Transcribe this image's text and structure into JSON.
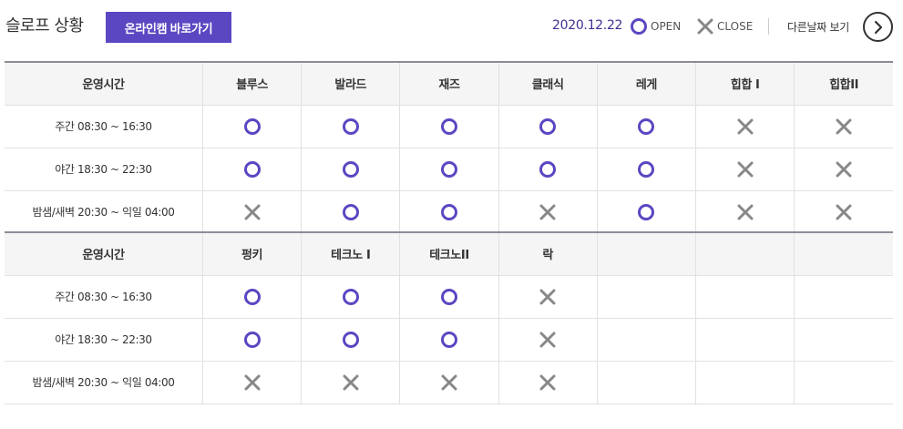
{
  "header": {
    "title": "슬로프 상황",
    "cam_button_label": "온라인캠 바로가기",
    "date": "2020.12.22",
    "legend_open": "OPEN",
    "legend_close": "CLOSE",
    "other_date_label": "다른날짜 보기"
  },
  "colors": {
    "accent": "#5b47c2",
    "date_text": "#3d3393",
    "close_icon": "#888888"
  },
  "table1": {
    "time_header": "운영시간",
    "columns": [
      "블루스",
      "발라드",
      "재즈",
      "클래식",
      "레게",
      "힙합 I",
      "힙합II"
    ],
    "rows": [
      {
        "time": "주간 08:30 ~ 16:30",
        "status": [
          "open",
          "open",
          "open",
          "open",
          "open",
          "close",
          "close"
        ]
      },
      {
        "time": "야간 18:30 ~ 22:30",
        "status": [
          "open",
          "open",
          "open",
          "open",
          "open",
          "close",
          "close"
        ]
      },
      {
        "time": "밤샘/새벽 20:30 ~ 익일 04:00",
        "status": [
          "close",
          "open",
          "open",
          "close",
          "open",
          "close",
          "close"
        ]
      }
    ]
  },
  "table2": {
    "time_header": "운영시간",
    "columns": [
      "펑키",
      "테크노 I",
      "테크노II",
      "락",
      "",
      "",
      ""
    ],
    "rows": [
      {
        "time": "주간 08:30 ~ 16:30",
        "status": [
          "open",
          "open",
          "open",
          "close",
          "",
          "",
          ""
        ]
      },
      {
        "time": "야간 18:30 ~ 22:30",
        "status": [
          "open",
          "open",
          "open",
          "close",
          "",
          "",
          ""
        ]
      },
      {
        "time": "밤샘/새벽 20:30 ~ 익일 04:00",
        "status": [
          "close",
          "close",
          "close",
          "close",
          "",
          "",
          ""
        ]
      }
    ]
  }
}
